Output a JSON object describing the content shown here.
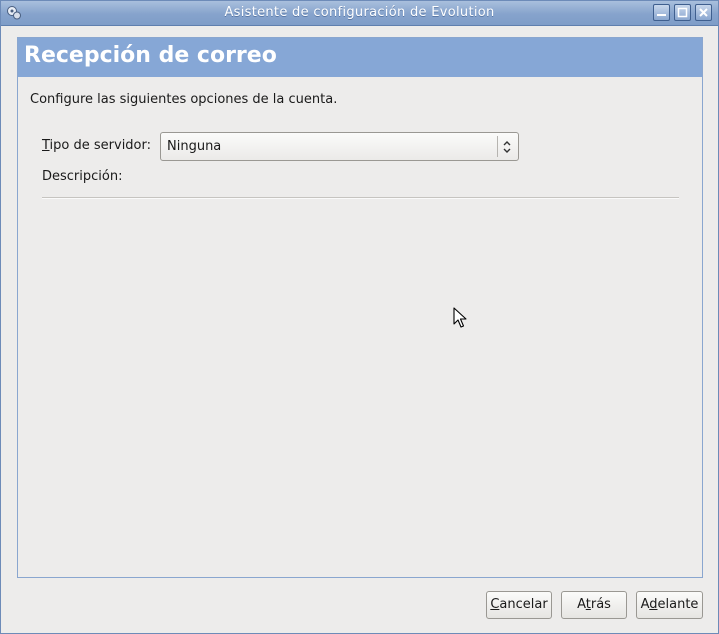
{
  "window": {
    "title": "Asistente de configuración de Evolution",
    "icons": [
      "app-icon",
      "minimize-icon",
      "maximize-icon",
      "close-icon"
    ]
  },
  "page": {
    "heading": "Recepción de correo",
    "intro": "Configure las siguientes opciones de la cuenta."
  },
  "server": {
    "label_mnemonic": "T",
    "label_rest": "ipo de servidor:",
    "selected": "Ninguna"
  },
  "description": {
    "label": "Descripción:"
  },
  "buttons": {
    "cancel": {
      "mnemonic": "C",
      "rest": "ancelar"
    },
    "back": {
      "pre": "A",
      "mnemonic": "t",
      "rest": "rás"
    },
    "forward": {
      "pre": "A",
      "mnemonic": "d",
      "rest": "elante"
    }
  },
  "colors": {
    "header_band": "#86a7d6",
    "titlebar": "#86a3cc",
    "background": "#edeceb"
  }
}
